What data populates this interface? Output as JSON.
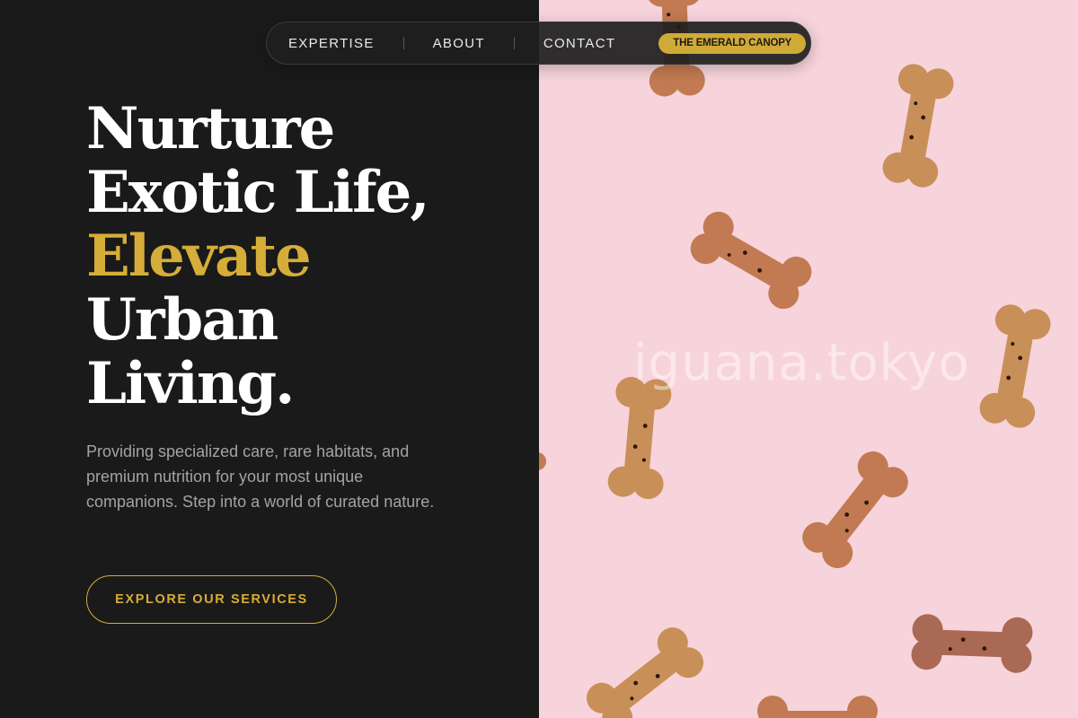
{
  "nav": {
    "links": [
      "EXPERTISE",
      "ABOUT",
      "CONTACT"
    ],
    "brand": "THE EMERALD CANOPY"
  },
  "hero": {
    "headline": {
      "line1": "Nurture",
      "line2": "Exotic Life,",
      "line3_accent": "Elevate",
      "line4": "Urban",
      "line5": "Living."
    },
    "description": "Providing specialized care, rare habitats, and premium nutrition for your most unique companions. Step into a world of curated nature.",
    "cta_label": "EXPLORE OUR SERVICES"
  },
  "image": {
    "subject": "dog-biscuit-bones-on-pink",
    "watermark": "iguana.tokyo"
  },
  "colors": {
    "background": "#1a1a1a",
    "accent": "#d5ad38",
    "image_background": "#f7d3dc"
  }
}
